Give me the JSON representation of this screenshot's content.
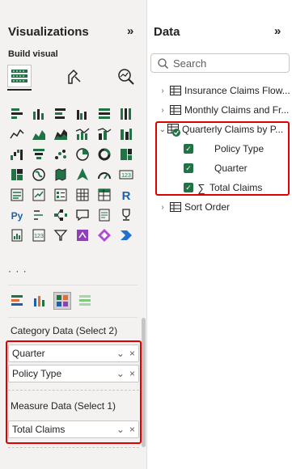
{
  "viz": {
    "title": "Visualizations",
    "collapse_glyph": "»",
    "build_visual_label": "Build visual",
    "more_glyph": "· · ·",
    "category_label": "Category Data (Select 2)",
    "category_fields": [
      "Quarter",
      "Policy Type"
    ],
    "measure_label": "Measure Data (Select 1)",
    "measure_fields": [
      "Total Claims"
    ],
    "field_controls": [
      "⌄",
      "×"
    ]
  },
  "data": {
    "title": "Data",
    "collapse_glyph": "»",
    "search_placeholder": "Search",
    "tables": [
      {
        "label": "Insurance Claims Flow..."
      },
      {
        "label": "Monthly Claims and Fr..."
      },
      {
        "label": "Quarterly Claims by P..."
      },
      {
        "label": "Sort Order"
      }
    ],
    "expanded_fields": [
      {
        "label": "Policy Type",
        "sigma": ""
      },
      {
        "label": "Quarter",
        "sigma": ""
      },
      {
        "label": "Total Claims",
        "sigma": "∑"
      }
    ]
  },
  "colors": {
    "accent": "#217346",
    "highlight_border": "#e00000",
    "pane_bg": "#f3f2f1"
  },
  "icons": [
    "chevron-double-right-icon",
    "search-icon",
    "table-icon",
    "checkbox-checked-icon",
    "sigma-icon",
    "stacked-bar-icon",
    "clustered-column-icon",
    "line-chart-icon",
    "pie-chart-icon",
    "donut-icon",
    "map-icon",
    "card-icon",
    "table-visual-icon",
    "matrix-icon",
    "r-script-icon",
    "python-icon",
    "trophy-icon"
  ]
}
